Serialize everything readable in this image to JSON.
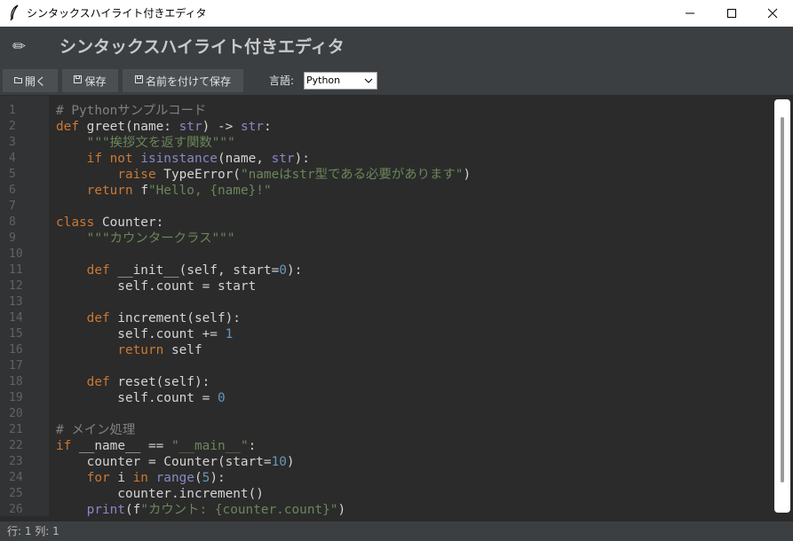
{
  "window": {
    "title": "シンタックスハイライト付きエディタ",
    "icon": "feather-icon",
    "controls": [
      "minimize-icon",
      "maximize-icon",
      "close-icon"
    ]
  },
  "header": {
    "icon": "pencil-icon",
    "title": "シンタックスハイライト付きエディタ"
  },
  "toolbar": {
    "open_label": "開く",
    "save_label": "保存",
    "saveas_label": "名前を付けて保存",
    "open_icon": "folder-icon",
    "save_icon": "floppy-icon",
    "saveas_icon": "floppy-icon",
    "language_label": "言語:",
    "language_value": "Python"
  },
  "editor": {
    "lines": [
      [
        [
          "# Pythonサンプルコード",
          "cm"
        ]
      ],
      [
        [
          "def ",
          "kw"
        ],
        [
          "greet(name: ",
          "fn"
        ],
        [
          "str",
          "bi"
        ],
        [
          ") -> ",
          "fn"
        ],
        [
          "str",
          "bi"
        ],
        [
          ":",
          "fn"
        ]
      ],
      [
        [
          "    ",
          "fn"
        ],
        [
          "\"\"\"挨拶文を返す関数\"\"\"",
          "str"
        ]
      ],
      [
        [
          "    ",
          "fn"
        ],
        [
          "if not ",
          "kw"
        ],
        [
          "isinstance",
          "bi"
        ],
        [
          "(name, ",
          "fn"
        ],
        [
          "str",
          "bi"
        ],
        [
          "):",
          "fn"
        ]
      ],
      [
        [
          "        ",
          "fn"
        ],
        [
          "raise ",
          "kw"
        ],
        [
          "TypeError(",
          "fn"
        ],
        [
          "\"nameはstr型である必要があります\"",
          "str"
        ],
        [
          ")",
          "fn"
        ]
      ],
      [
        [
          "    ",
          "fn"
        ],
        [
          "return ",
          "kw"
        ],
        [
          "f",
          "fn"
        ],
        [
          "\"Hello, {name}!\"",
          "str"
        ]
      ],
      [],
      [
        [
          "class ",
          "kw"
        ],
        [
          "Counter:",
          "fn"
        ]
      ],
      [
        [
          "    ",
          "fn"
        ],
        [
          "\"\"\"カウンタークラス\"\"\"",
          "str"
        ]
      ],
      [],
      [
        [
          "    ",
          "fn"
        ],
        [
          "def ",
          "kw"
        ],
        [
          "__init__(self, start=",
          "fn"
        ],
        [
          "0",
          "num"
        ],
        [
          "):",
          "fn"
        ]
      ],
      [
        [
          "        self.count = start",
          "fn"
        ]
      ],
      [],
      [
        [
          "    ",
          "fn"
        ],
        [
          "def ",
          "kw"
        ],
        [
          "increment(self):",
          "fn"
        ]
      ],
      [
        [
          "        self.count += ",
          "fn"
        ],
        [
          "1",
          "num"
        ]
      ],
      [
        [
          "        ",
          "fn"
        ],
        [
          "return ",
          "kw"
        ],
        [
          "self",
          "fn"
        ]
      ],
      [],
      [
        [
          "    ",
          "fn"
        ],
        [
          "def ",
          "kw"
        ],
        [
          "reset(self):",
          "fn"
        ]
      ],
      [
        [
          "        self.count = ",
          "fn"
        ],
        [
          "0",
          "num"
        ]
      ],
      [],
      [
        [
          "# メイン処理",
          "cm"
        ]
      ],
      [
        [
          "if ",
          "kw"
        ],
        [
          "__name__ == ",
          "fn"
        ],
        [
          "\"__main__\"",
          "str"
        ],
        [
          ":",
          "fn"
        ]
      ],
      [
        [
          "    counter = Counter(start=",
          "fn"
        ],
        [
          "10",
          "num"
        ],
        [
          ")",
          "fn"
        ]
      ],
      [
        [
          "    ",
          "fn"
        ],
        [
          "for ",
          "kw"
        ],
        [
          "i ",
          "fn"
        ],
        [
          "in ",
          "kw"
        ],
        [
          "range",
          "bi"
        ],
        [
          "(",
          "fn"
        ],
        [
          "5",
          "num"
        ],
        [
          "):",
          "fn"
        ]
      ],
      [
        [
          "        counter.increment()",
          "fn"
        ]
      ],
      [
        [
          "    ",
          "fn"
        ],
        [
          "print",
          "bi"
        ],
        [
          "(f",
          "fn"
        ],
        [
          "\"カウント: {counter.count}\"",
          "str"
        ],
        [
          ")",
          "fn"
        ]
      ]
    ]
  },
  "statusbar": {
    "text": "行: 1 列: 1"
  },
  "colors": {
    "background": "#2b2b2b",
    "panel": "#3c3f41",
    "keyword": "#cc7832",
    "string": "#6a8759",
    "comment": "#808080",
    "number": "#6897bb",
    "builtin": "#8888c6"
  }
}
